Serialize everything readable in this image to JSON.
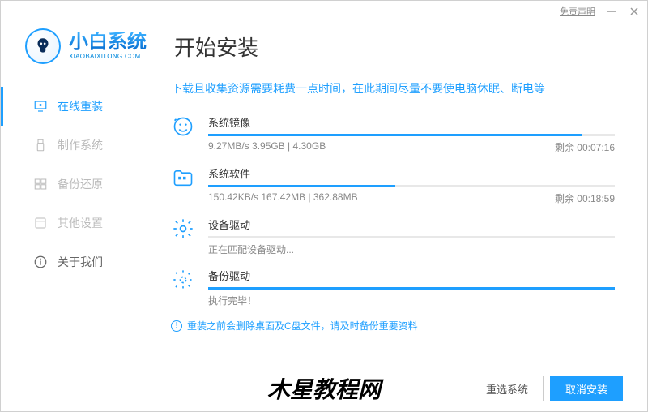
{
  "titlebar": {
    "disclaimer": "免责声明"
  },
  "brand": {
    "cn": "小白系统",
    "en": "XIAOBAIXITONG.COM"
  },
  "pageTitle": "开始安装",
  "sidebar": {
    "items": [
      {
        "label": "在线重装"
      },
      {
        "label": "制作系统"
      },
      {
        "label": "备份还原"
      },
      {
        "label": "其他设置"
      },
      {
        "label": "关于我们"
      }
    ]
  },
  "notice": "下载且收集资源需要耗费一点时间，在此期间尽量不要使电脑休眠、断电等",
  "tasks": [
    {
      "title": "系统镜像",
      "detail": "9.27MB/s 3.95GB | 4.30GB",
      "remain": "剩余 00:07:16",
      "progress": 92
    },
    {
      "title": "系统软件",
      "detail": "150.42KB/s 167.42MB | 362.88MB",
      "remain": "剩余 00:18:59",
      "progress": 46
    },
    {
      "title": "设备驱动",
      "detail": "正在匹配设备驱动...",
      "remain": "",
      "progress": 0
    },
    {
      "title": "备份驱动",
      "detail": "执行完毕！",
      "remain": "",
      "progress": 100
    }
  ],
  "warning": "重装之前会删除桌面及C盘文件，请及时备份重要资料",
  "footer": {
    "reselect": "重选系统",
    "cancel": "取消安装"
  },
  "watermark": "木星教程网"
}
